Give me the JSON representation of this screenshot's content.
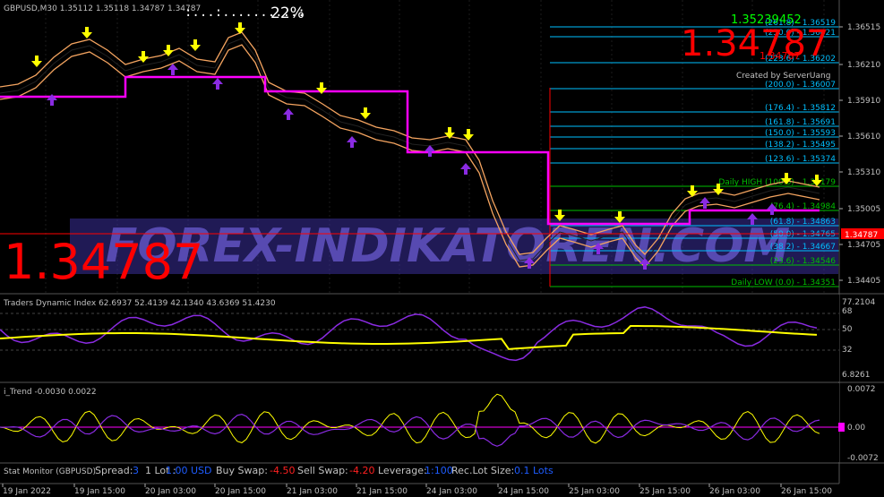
{
  "header": {
    "symbol_info": "GBPUSD,M30  1.35112 1.35118 1.34787 1.34787",
    "progress_dots": ":...:..........:",
    "progress_pct": "22%"
  },
  "price": {
    "big_price_right": "1.34787",
    "big_price_left": "1.34787",
    "current_price_label": "1.34787",
    "bid_line": "1.35239",
    "spread_pts": "452",
    "credit": "Created by ServerUang",
    "ask_hint": "1.34787"
  },
  "colors": {
    "ma_line": "#ff00ff",
    "envelope": "#f4a460",
    "price_line": "#000000",
    "up_arrow": "#8a2be2",
    "down_arrow": "#ffff00",
    "fib_cyan": "#00bfff",
    "fib_green": "#00c000",
    "current_price": "#ff0000",
    "tdi_purple": "#8a2be2",
    "tdi_yellow": "#ffff00"
  },
  "price_axis_ticks": [
    "1.36515",
    "1.36210",
    "1.35910",
    "1.35610",
    "1.35310",
    "1.35005",
    "1.34705",
    "1.34405"
  ],
  "fib_levels": [
    {
      "label": "(261.8) - 1.36519",
      "color": "cyan"
    },
    {
      "label": "(250.0) - 1.36421",
      "color": "cyan"
    },
    {
      "label": "(223.6) - 1.36202",
      "color": "cyan"
    },
    {
      "label": "(200.0) - 1.36007",
      "color": "cyan"
    },
    {
      "label": "(176.4) - 1.35812",
      "color": "cyan"
    },
    {
      "label": "(161.8) - 1.35691",
      "color": "cyan"
    },
    {
      "label": "(150.0) - 1.35593",
      "color": "cyan"
    },
    {
      "label": "(138.2) - 1.35495",
      "color": "cyan"
    },
    {
      "label": "(123.6) - 1.35374",
      "color": "cyan"
    },
    {
      "label": "Daily HIGH (100.0) - 1.35179",
      "color": "green"
    },
    {
      "label": "(76.4) - 1.34984",
      "color": "green"
    },
    {
      "label": "(61.8) - 1.34863",
      "color": "cyan"
    },
    {
      "label": "(50.0) - 1.34765",
      "color": "cyan"
    },
    {
      "label": "(38.2) - 1.34667",
      "color": "cyan"
    },
    {
      "label": "(23.6) - 1.34546",
      "color": "green"
    },
    {
      "label": "Daily LOW (0.0) - 1.34351",
      "color": "green"
    }
  ],
  "watermark": "FOREX-INDIKATOREN.COM",
  "tdi": {
    "title": "Traders Dynamic Index 62.6937 52.4139 42.1340 43.6369 51.4230",
    "axis": [
      "77.2104",
      "68",
      "50",
      "32",
      "6.8261"
    ]
  },
  "trend": {
    "title": "i_Trend -0.0030 0.0022",
    "axis": [
      "0.0072",
      "0.00",
      "-0.0072"
    ]
  },
  "stat_monitor": {
    "title": "Stat Monitor (GBPUSD)",
    "spread_label": "Spread:",
    "spread_value": "3",
    "lot_label": "1 Lot :",
    "lot_value": "1.00 USD",
    "buy_swap_label": "Buy Swap:",
    "buy_swap_value": "-4.50",
    "sell_swap_label": "Sell Swap:",
    "sell_swap_value": "-4.20",
    "leverage_label": "Leverage:",
    "leverage_value": "1:100",
    "rec_lot_label": "Rec.Lot Size:",
    "rec_lot_value": "0.1 Lots"
  },
  "time_axis": [
    "19 Jan 2022",
    "19 Jan 15:00",
    "20 Jan 03:00",
    "20 Jan 15:00",
    "21 Jan 03:00",
    "21 Jan 15:00",
    "24 Jan 03:00",
    "24 Jan 15:00",
    "25 Jan 03:00",
    "25 Jan 15:00",
    "26 Jan 03:00",
    "26 Jan 15:00"
  ]
}
